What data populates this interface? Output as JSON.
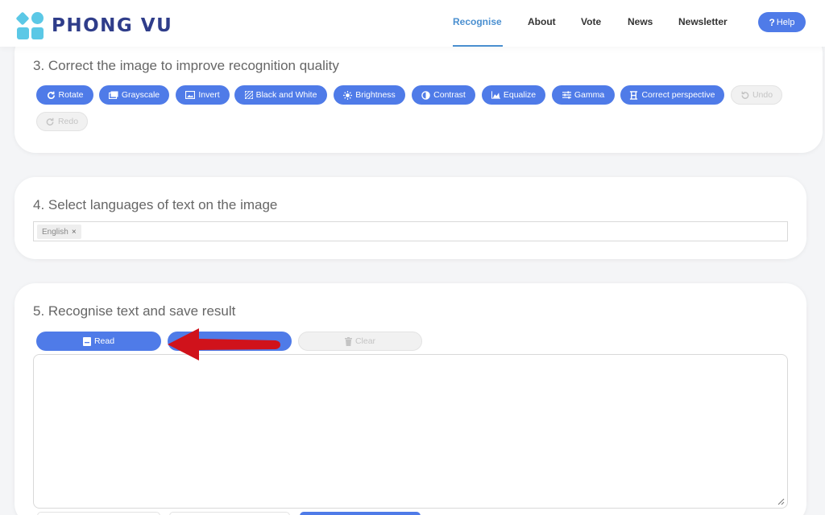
{
  "header": {
    "logo_text": "PHONG VU",
    "nav": [
      {
        "label": "Recognise",
        "active": true
      },
      {
        "label": "About",
        "active": false
      },
      {
        "label": "Vote",
        "active": false
      },
      {
        "label": "News",
        "active": false
      },
      {
        "label": "Newsletter",
        "active": false
      }
    ],
    "help_label": "Help"
  },
  "section3": {
    "title": "3. Correct the image to improve recognition quality",
    "buttons": [
      {
        "label": "Rotate",
        "icon": "rotate-icon",
        "disabled": false
      },
      {
        "label": "Grayscale",
        "icon": "grayscale-icon",
        "disabled": false
      },
      {
        "label": "Invert",
        "icon": "invert-icon",
        "disabled": false
      },
      {
        "label": "Black and White",
        "icon": "black-white-icon",
        "disabled": false
      },
      {
        "label": "Brightness",
        "icon": "brightness-icon",
        "disabled": false
      },
      {
        "label": "Contrast",
        "icon": "contrast-icon",
        "disabled": false
      },
      {
        "label": "Equalize",
        "icon": "equalize-icon",
        "disabled": false
      },
      {
        "label": "Gamma",
        "icon": "gamma-icon",
        "disabled": false
      },
      {
        "label": "Correct perspective",
        "icon": "perspective-icon",
        "disabled": false
      },
      {
        "label": "Undo",
        "icon": "undo-icon",
        "disabled": true
      },
      {
        "label": "Redo",
        "icon": "redo-icon",
        "disabled": true
      }
    ]
  },
  "section4": {
    "title": "4. Select languages of text on the image",
    "selected_languages": [
      "English"
    ],
    "remove_symbol": "×"
  },
  "section5": {
    "title": "5. Recognise text and save result",
    "read_label": "Read",
    "clear_label": "Clear",
    "result_text": ""
  },
  "colors": {
    "accent": "#4f7be8",
    "nav_active": "#4a8fd0",
    "logo": "#2f3d8a",
    "logo_mark": "#5bc8e6",
    "annotation_arrow": "#d0121b",
    "disabled_bg": "#f1f1f1"
  }
}
